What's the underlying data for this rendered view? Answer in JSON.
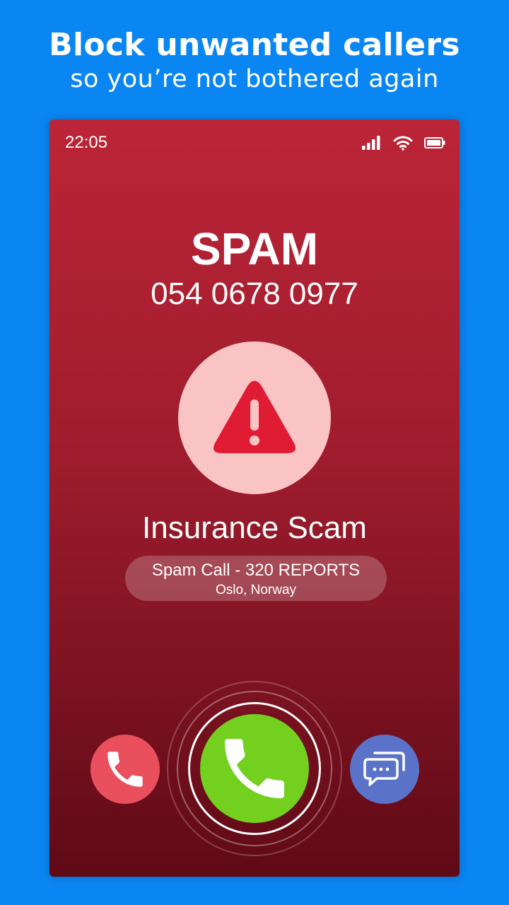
{
  "promo": {
    "headline": "Block unwanted callers",
    "subline": "so you’re not bothered again"
  },
  "status_bar": {
    "time": "22:05",
    "icons": [
      "signal-icon",
      "wifi-icon",
      "battery-icon"
    ]
  },
  "call": {
    "title": "SPAM",
    "number": "054 0678 0977",
    "warning_icon": "warning-triangle-icon",
    "category": "Insurance Scam",
    "reports": "Spam Call - 320 REPORTS",
    "location": "Oslo, Norway"
  },
  "actions": {
    "decline_icon": "phone-icon",
    "answer_icon": "phone-icon",
    "message_icon": "chat-bubbles-icon"
  },
  "colors": {
    "background": "#0a86f3",
    "screen_top": "#bb2537",
    "screen_bottom": "#5f0a16",
    "warning_circle": "#fbc4c4",
    "warning_icon": "#e01c34",
    "decline": "#ea4f5e",
    "answer": "#74d01f",
    "message": "#5a73c9"
  }
}
